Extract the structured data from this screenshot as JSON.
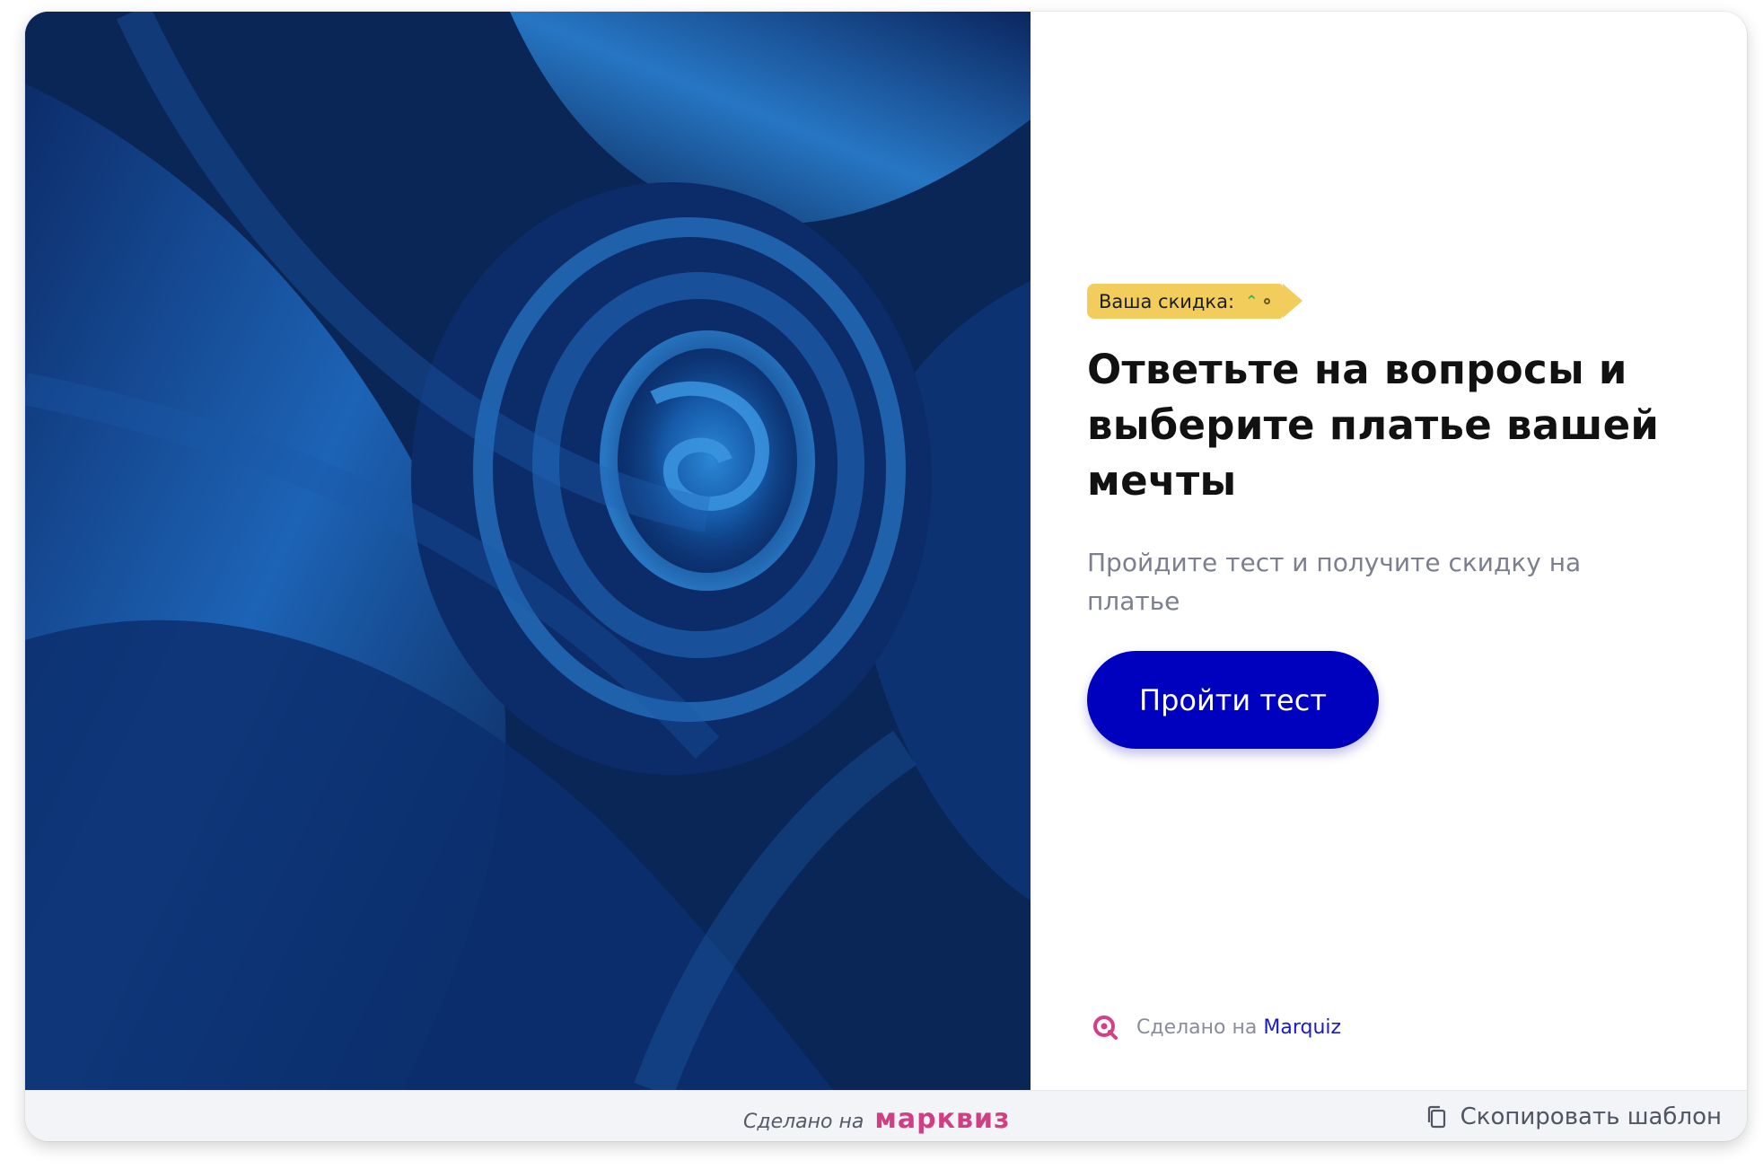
{
  "hero": {
    "image_alt": "Blue satin fabric swirl"
  },
  "badge": {
    "label": "Ваша скидка:",
    "icon": "double-chevron-up-icon"
  },
  "title": "Ответьте на вопросы и выберите платье вашей мечты",
  "subtitle": "Пройдите тест и получите скидку на платье",
  "cta_label": "Пройти тест",
  "made_with": {
    "prefix": "Сделано на",
    "brand": "Marquiz"
  },
  "footer": {
    "made_prefix": "Сделано на",
    "made_brand": "марквиз",
    "copy_label": "Скопировать шаблон"
  },
  "colors": {
    "accent": "#0000bf",
    "badge": "#f3cd5c",
    "brand_pink": "#cf3f82",
    "link_blue": "#1a1ac8"
  }
}
